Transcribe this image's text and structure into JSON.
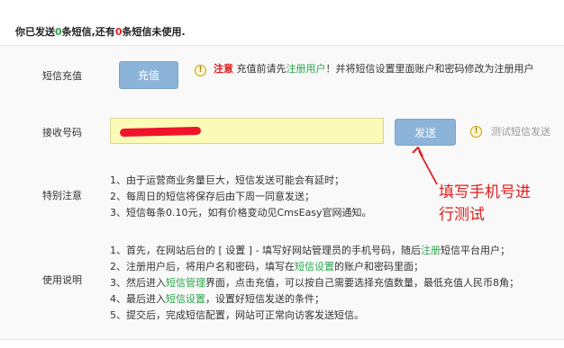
{
  "summary": {
    "part1": "你已发送",
    "sent_count": "0",
    "part2": "条短信,还有",
    "unused_count": "0",
    "part3": "条短信未使用."
  },
  "recharge": {
    "label": "短信充值",
    "button": "充值",
    "notice_prefix": "注意",
    "notice_mid": "充值前请先",
    "notice_link": "注册用户",
    "notice_suffix": "！并将短信设置里面账户和密码修改为注册用户"
  },
  "receive": {
    "label": "接收号码",
    "input_value": "",
    "send_button": "发送",
    "hint": "测试短信发送"
  },
  "special_notes": {
    "label": "特别注意",
    "items": [
      "1、由于运营商业务量巨大，短信发送可能会有延时；",
      "2、每周日的短信将保存后由下周一同意发送；",
      "3、短信每条0.10元，如有价格变动见CmsEasy官网通知。"
    ]
  },
  "usage": {
    "label": "使用说明",
    "line1_a": "1、首先，在网站后台的 [ 设置 ] - 填写好网站管理员的手机号码，随后",
    "line1_link": "注册",
    "line1_b": "短信平台用户；",
    "line2_a": "2、注册用户后，将用户名和密码，填写在",
    "line2_link": "短信设置",
    "line2_b": "的账户和密码里面；",
    "line3_a": "3、然后进入",
    "line3_link": "短信管理",
    "line3_b": "界面，点击充值，可以按自己需要选择充值数量，最低充值人民币8角；",
    "line4_a": "4、最后进入",
    "line4_link": "短信设置",
    "line4_b": "，设置好短信发送的条件；",
    "line5": "5、提交后，完成短信配置，网站可正常向访客发送短信。"
  },
  "annotation": {
    "line1": "填写手机号进",
    "line2": "行测试"
  },
  "colors": {
    "button": "#8cb4d8",
    "input_bg": "#fbfbb7",
    "accent_green": "#2aa64c",
    "accent_red": "#e21d1d"
  },
  "icons": [
    "warning-icon",
    "arrow-annotation"
  ]
}
